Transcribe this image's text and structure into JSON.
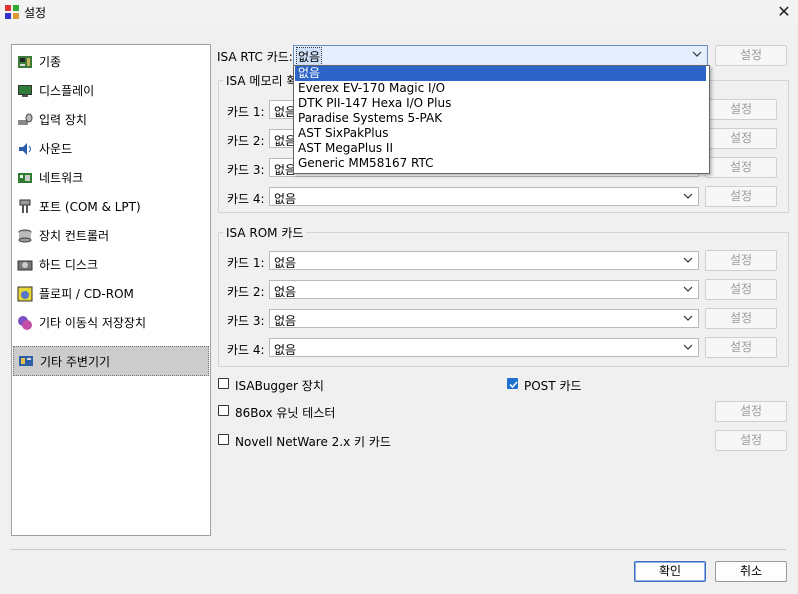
{
  "window": {
    "title": "설정",
    "close_label": "✕"
  },
  "sidebar": {
    "items": [
      {
        "label": "기종",
        "icon": "motherboard-icon"
      },
      {
        "label": "디스플레이",
        "icon": "display-icon"
      },
      {
        "label": "입력 장치",
        "icon": "input-icon"
      },
      {
        "label": "사운드",
        "icon": "sound-icon"
      },
      {
        "label": "네트워크",
        "icon": "network-icon"
      },
      {
        "label": "포트 (COM & LPT)",
        "icon": "port-icon"
      },
      {
        "label": "장치 컨트롤러",
        "icon": "controller-icon"
      },
      {
        "label": "하드 디스크",
        "icon": "harddisk-icon"
      },
      {
        "label": "플로피 / CD-ROM",
        "icon": "floppy-icon"
      },
      {
        "label": "기타 이동식 저장장치",
        "icon": "removable-icon"
      },
      {
        "label": "기타 주변기기",
        "icon": "peripheral-icon",
        "selected": true
      }
    ]
  },
  "rtc": {
    "label": "ISA RTC 카드:",
    "value": "없음",
    "config_label": "설정",
    "options": [
      "없음",
      "Everex EV-170 Magic I/O",
      "DTK PII-147 Hexa I/O Plus",
      "Paradise Systems 5-PAK",
      "AST SixPakPlus",
      "AST MegaPlus II",
      "Generic MM58167 RTC"
    ]
  },
  "mem_group": {
    "title": "ISA 메모리 확장 카드",
    "rows": [
      {
        "label": "카드 1:",
        "value": "없음",
        "config_label": "설정"
      },
      {
        "label": "카드 2:",
        "value": "없음",
        "config_label": "설정"
      },
      {
        "label": "카드 3:",
        "value": "없음",
        "config_label": "설정"
      },
      {
        "label": "카드 4:",
        "value": "없음",
        "config_label": "설정"
      }
    ]
  },
  "rom_group": {
    "title": "ISA ROM 카드",
    "rows": [
      {
        "label": "카드 1:",
        "value": "없음",
        "config_label": "설정"
      },
      {
        "label": "카드 2:",
        "value": "없음",
        "config_label": "설정"
      },
      {
        "label": "카드 3:",
        "value": "없음",
        "config_label": "설정"
      },
      {
        "label": "카드 4:",
        "value": "없음",
        "config_label": "설정"
      }
    ]
  },
  "checks": {
    "isabugger": {
      "label": "ISABugger 장치",
      "checked": false
    },
    "post": {
      "label": "POST 카드",
      "checked": true
    },
    "unit_tester": {
      "label": "86Box 유닛 테스터",
      "checked": false,
      "config_label": "설정"
    },
    "netware": {
      "label": "Novell NetWare 2.x 키 카드",
      "checked": false,
      "config_label": "설정"
    }
  },
  "footer": {
    "ok_label": "확인",
    "cancel_label": "취소"
  },
  "colors": {
    "selection": "#2d64c8",
    "check_accent": "#1f6fd1"
  }
}
